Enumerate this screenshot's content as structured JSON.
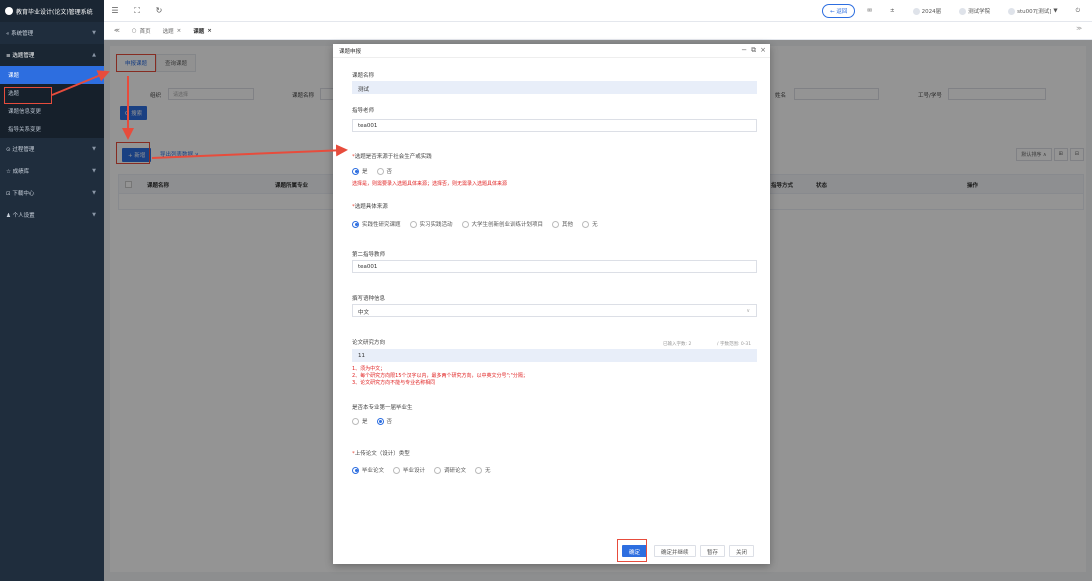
{
  "sidebar": {
    "logo": "教育毕业设计(论文)管理系统",
    "items": [
      {
        "label": "« 系统管理"
      },
      {
        "label": "≡ 选题管理"
      },
      {
        "label": "⊙ 过程管理"
      },
      {
        "label": "☆ 成绩库"
      },
      {
        "label": "⊡ 下载中心"
      },
      {
        "label": "♟ 个人设置"
      }
    ],
    "subitems": [
      {
        "label": "课题"
      },
      {
        "label": "选题"
      },
      {
        "label": "课题信息变更"
      },
      {
        "label": "指导关系变更"
      }
    ]
  },
  "topbar": {
    "back_label": "← 返回",
    "year_label": "2024届",
    "org_label": "测试学院",
    "user_label": "stu007[测试]"
  },
  "tabstrip": {
    "prev": "≪",
    "tabs": [
      {
        "label": "首页"
      },
      {
        "label": "选题"
      },
      {
        "label": "课题"
      }
    ],
    "end": "≫"
  },
  "main": {
    "subtabs": [
      {
        "label": "申报课题"
      },
      {
        "label": "查询课题"
      }
    ],
    "filters": {
      "group_label": "组织",
      "group_placeholder": "请选择",
      "name_label": "课题名称",
      "teacher_label": "姓名",
      "id_label": "工号/学号"
    },
    "search_label": "Q 搜索",
    "add_label": "+ 新增",
    "export_label": "导出列表数据 ∨",
    "sort_label": "默认排序 ∧",
    "table_headers": [
      "课题名称",
      "课题所属专业",
      "指导方式",
      "状态",
      "操作"
    ]
  },
  "modal": {
    "title": "课题申报",
    "fields": {
      "topic_name_label": "课题名称",
      "topic_name_value": "测试",
      "advisor_label": "指导老师",
      "advisor_value": "tea001",
      "from_practice_label": "选题是否来源于社会生产或实践",
      "from_practice_options": [
        "是",
        "否"
      ],
      "from_practice_hint": "选择是，则需要录入选题具体来源；选择否，则无需录入选题具体来源",
      "source_label": "选题具体来源",
      "source_options": [
        "实践性研究课题",
        "实习实践活动",
        "大学生创新创业训练计划项目",
        "其他",
        "无"
      ],
      "second_advisor_label": "第二指导教师",
      "second_advisor_value": "tea001",
      "language_label": "撰写语种信息",
      "language_value": "中文",
      "direction_label": "论文研究方向",
      "direction_value": "11",
      "direction_count": "已输入字数: 2",
      "direction_limit": "/ 字数范围: 0-31",
      "direction_rule_1": "1、须为中文；",
      "direction_rule_2": "2、每个研究方向限15个汉字以内，最多两个研究方向，以中英文分号\";\"分隔；",
      "direction_rule_3": "3、论文研究方向不能与专业名称相同",
      "first_grad_label": "是否本专业第一届毕业生",
      "first_grad_options": [
        "是",
        "否"
      ],
      "upload_type_label": "上传论文（设计）类型",
      "upload_type_options": [
        "毕业论文",
        "毕业设计",
        "调研论文",
        "无"
      ]
    },
    "buttons": {
      "confirm": "确定",
      "confirm_next": "确定并继续",
      "save_draft": "暂存",
      "close": "关闭"
    }
  },
  "colors": {
    "primary": "#2d6ee0",
    "sidebar": "#1f2d3d",
    "highlight": "#e74c3c",
    "warning_text": "#e02020"
  }
}
